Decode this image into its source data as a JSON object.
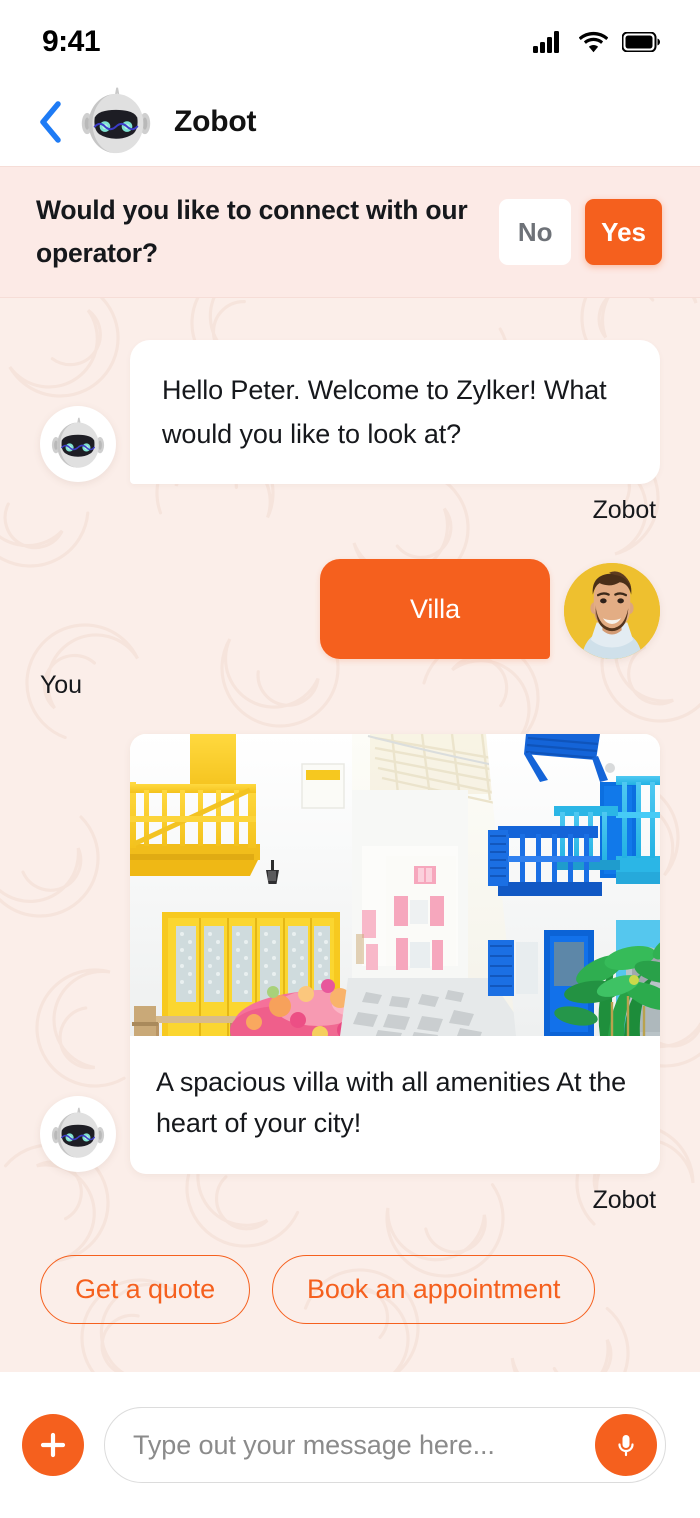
{
  "status_bar": {
    "time": "9:41",
    "signal_icon": "cellular-signal-icon",
    "wifi_icon": "wifi-icon",
    "battery_icon": "battery-full-icon"
  },
  "header": {
    "back_icon": "chevron-left-icon",
    "avatar_icon": "zobot-robot-avatar",
    "title": "Zobot"
  },
  "operator_banner": {
    "question": "Would you like to connect with our operator?",
    "no_label": "No",
    "yes_label": "Yes"
  },
  "conversation": [
    {
      "sender": "Zobot",
      "side": "bot",
      "text": "Hello Peter. Welcome to Zylker! What would you like to look at?"
    },
    {
      "sender": "You",
      "side": "user",
      "text": "Villa"
    },
    {
      "sender": "Zobot",
      "side": "bot",
      "card": {
        "image_alt": "mediterranean-villa-street-photo",
        "caption": "A spacious villa with all amenities At the heart of your city!"
      }
    }
  ],
  "suggestions": [
    {
      "label": "Get a quote"
    },
    {
      "label": "Book an appointment"
    }
  ],
  "composer": {
    "attach_icon": "plus-icon",
    "placeholder": "Type out your message here...",
    "value": "",
    "mic_icon": "microphone-icon"
  },
  "colors": {
    "accent": "#f5601e",
    "chat_background": "#fbeee9",
    "banner_background": "#fceae6",
    "back_arrow": "#1e7bf5",
    "user_avatar_background": "#eec02f"
  }
}
